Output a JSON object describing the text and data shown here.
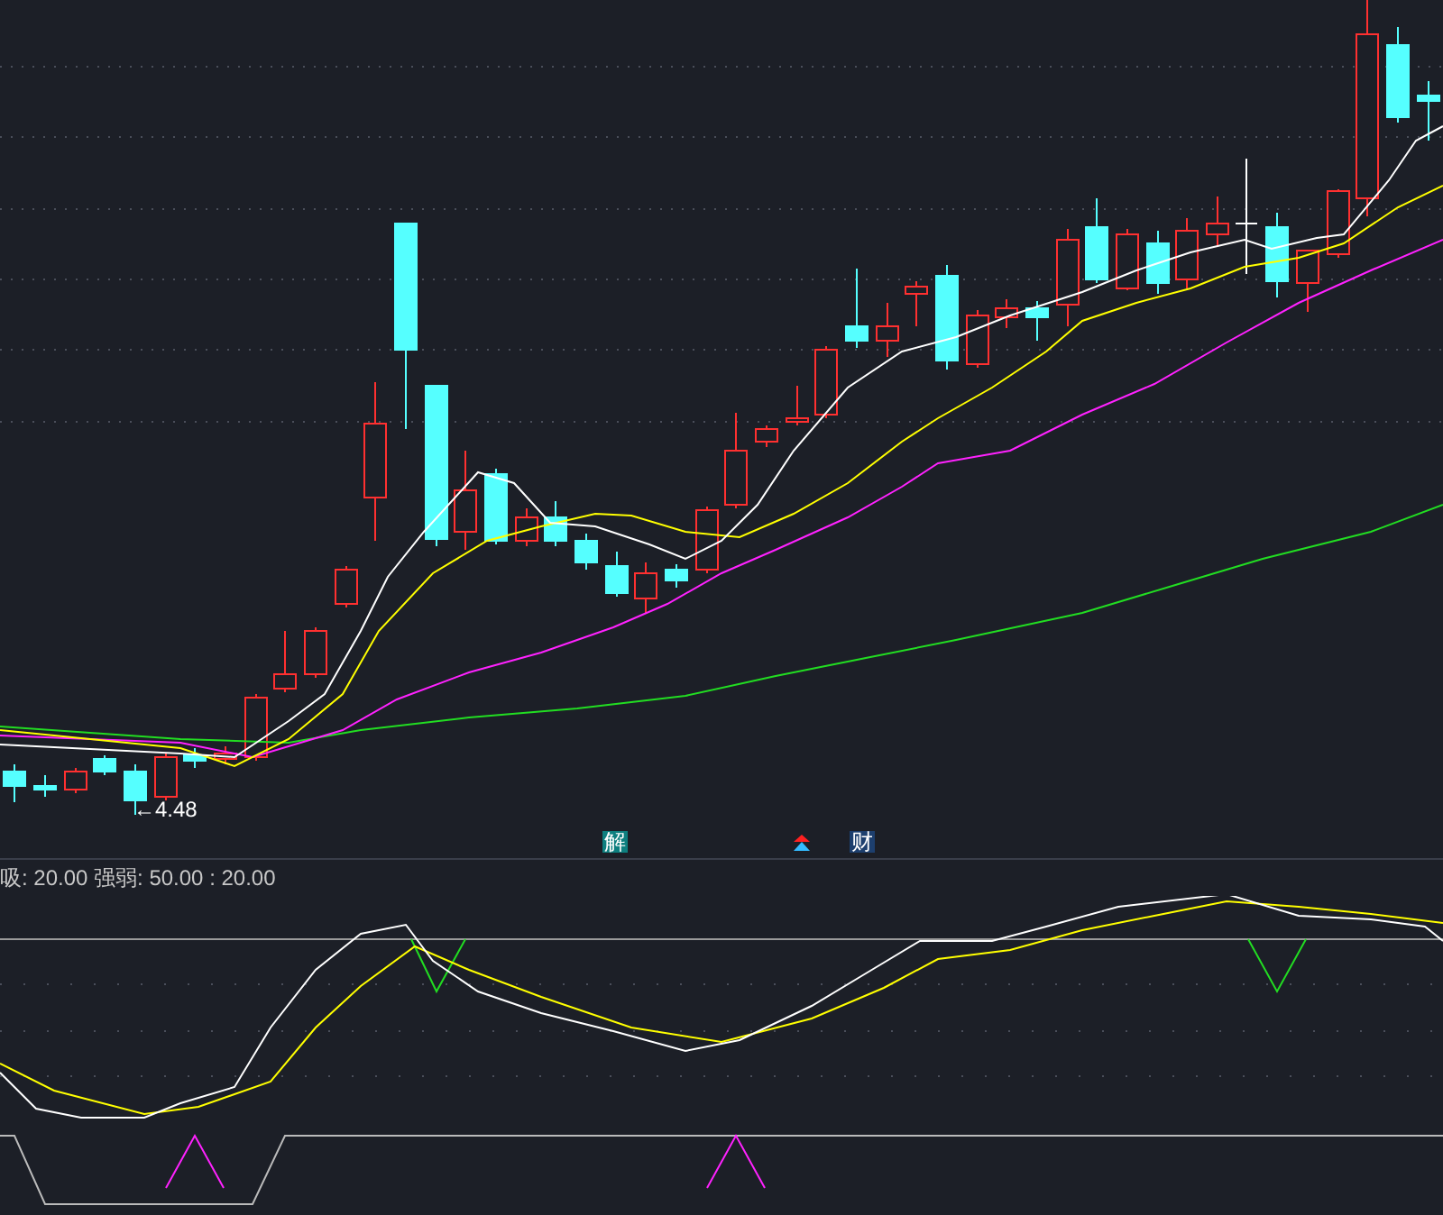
{
  "price_chart": {
    "low_marker": "←4.48",
    "event_markers": [
      {
        "kind": "tag",
        "text": "解",
        "color": "#0e7f7f"
      },
      {
        "kind": "arrow"
      },
      {
        "kind": "tag",
        "text": "财",
        "color": "#1d3f6e"
      }
    ]
  },
  "indicator_panel": {
    "legend": "吸: 20.00 强弱: 50.00 : 20.00"
  }
}
